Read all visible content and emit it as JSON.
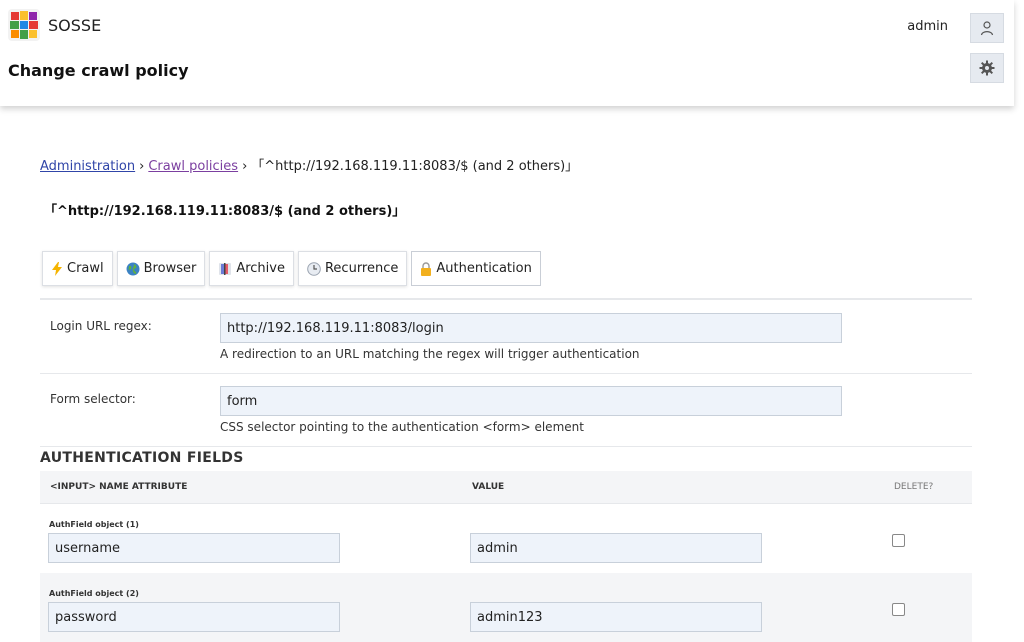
{
  "app": {
    "name": "SOSSE",
    "page_title": "Change crawl policy"
  },
  "user": {
    "name": "admin"
  },
  "breadcrumb": {
    "items": [
      "Administration",
      "Crawl policies"
    ],
    "separator": "›",
    "current": "「^http://192.168.119.11:8083/$ (and 2 others)」"
  },
  "heading": "「^http://192.168.119.11:8083/$ (and 2 others)」",
  "tabs": [
    {
      "label": "Crawl",
      "icon": "lightning-icon"
    },
    {
      "label": "Browser",
      "icon": "globe-icon"
    },
    {
      "label": "Archive",
      "icon": "archive-book-icon"
    },
    {
      "label": "Recurrence",
      "icon": "clock-icon"
    },
    {
      "label": "Authentication",
      "icon": "lock-icon",
      "active": true
    }
  ],
  "fields": {
    "login_url": {
      "label": "Login URL regex:",
      "value": "http://192.168.119.11:8083/login",
      "help": "A redirection to an URL matching the regex will trigger authentication"
    },
    "form_selector": {
      "label": "Form selector:",
      "value": "form",
      "help": "CSS selector pointing to the authentication <form> element"
    }
  },
  "auth_fields": {
    "title": "AUTHENTICATION FIELDS",
    "columns": {
      "name": "<INPUT> NAME ATTRIBUTE",
      "value": "VALUE",
      "delete": "DELETE?"
    },
    "rows": [
      {
        "label": "AuthField object (1)",
        "name": "username",
        "value": "admin",
        "delete": false
      },
      {
        "label": "AuthField object (2)",
        "name": "password",
        "value": "admin123",
        "delete": false
      }
    ]
  },
  "colors": {
    "link": "#3045a8",
    "visited_link": "#7b3fa0",
    "input_bg": "#eef3fa"
  }
}
